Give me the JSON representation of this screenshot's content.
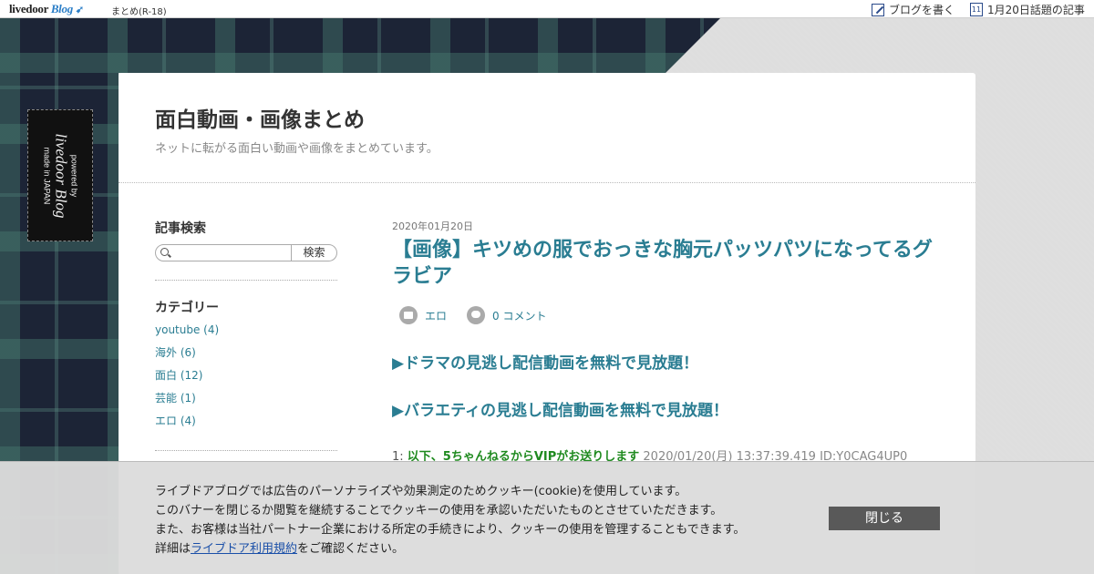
{
  "topbar": {
    "logo_text": "livedoor",
    "logo_blog": "Blog",
    "nav_tag": "まとめ(R-18)",
    "write_label": "ブログを書く",
    "calendar_day": "11",
    "trend_label": "1月20日話題の記事"
  },
  "side_tag": {
    "powered": "powered by",
    "brand": "livedoor Blog",
    "made": "made in JAPAN"
  },
  "header": {
    "title": "面白動画・画像まとめ",
    "description": "ネットに転がる面白い動画や画像をまとめています。"
  },
  "sidebar": {
    "search_heading": "記事検索",
    "search_button": "検索",
    "category_heading": "カテゴリー",
    "categories": [
      {
        "label": "youtube (4)"
      },
      {
        "label": "海外 (6)"
      },
      {
        "label": "面白 (12)"
      },
      {
        "label": "芸能 (1)"
      },
      {
        "label": "エロ (4)"
      }
    ]
  },
  "article": {
    "date": "2020年01月20日",
    "title": "【画像】キツめの服でおっきな胸元パッツパツになってるグラビア",
    "category": "エロ",
    "comments": "0 コメント",
    "promo1": "▶ドラマの見逃し配信動画を無料で見放題！",
    "promo2": "▶バラエティの見逃し配信動画を無料で見放題！",
    "res_num": "1: ",
    "res_name": "以下、5ちゃんねるからVIPがお送りします",
    "res_info": " 2020/01/20(月) 13:37:39.419 ID:Y0CAG4UP0"
  },
  "cookie": {
    "line1": "ライブドアブログでは広告のパーソナライズや効果測定のためクッキー(cookie)を使用しています。",
    "line2": "このバナーを閉じるか閲覧を継続することでクッキーの使用を承認いただいたものとさせていただきます。",
    "line3": "また、お客様は当社パートナー企業における所定の手続きにより、クッキーの使用を管理することもできます。",
    "line4_prefix": "詳細は",
    "line4_link": "ライブドア利用規約",
    "line4_suffix": "をご確認ください。",
    "close_label": "閉じる"
  }
}
